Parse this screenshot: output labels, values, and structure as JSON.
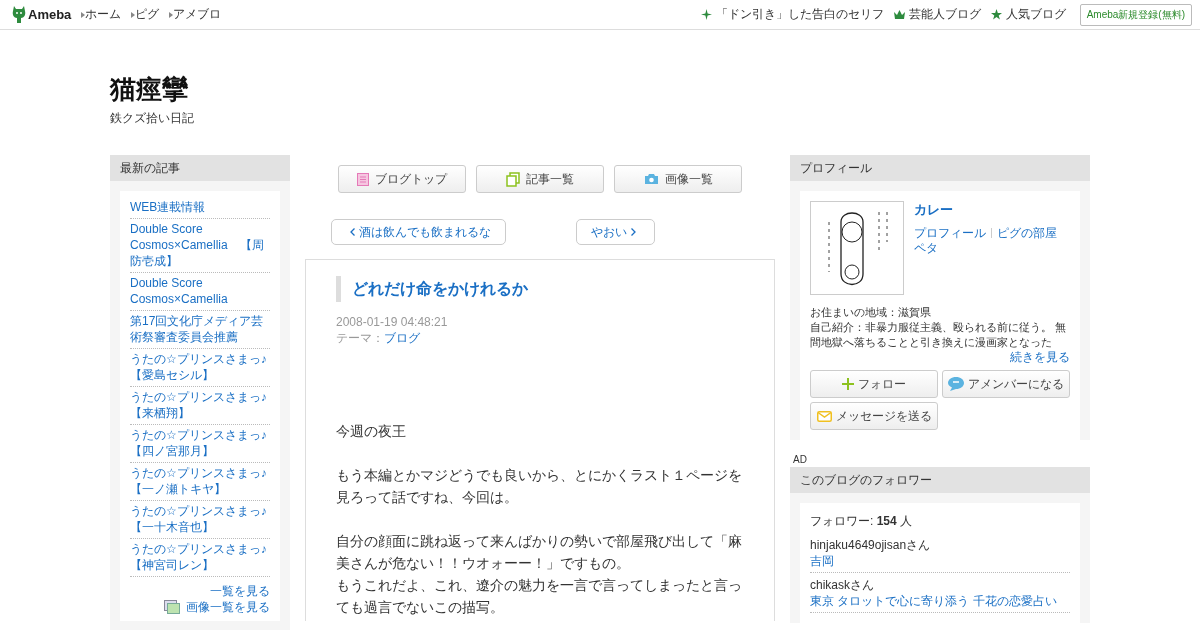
{
  "topbar": {
    "logo": "Ameba",
    "nav": [
      "ホーム",
      "ピグ",
      "アメブロ"
    ],
    "links": [
      {
        "kind": "sparkle",
        "label": "「ドン引き」した告白のセリフ"
      },
      {
        "kind": "crown",
        "label": "芸能人ブログ"
      },
      {
        "kind": "star",
        "label": "人気ブログ"
      }
    ],
    "register": "Ameba新規登録(無料)"
  },
  "blog": {
    "title": "猫痙攣",
    "subtitle": "鉄クズ拾い日記"
  },
  "recent": {
    "heading": "最新の記事",
    "items": [
      "WEB連載情報",
      "Double Score Cosmos×Camellia　【周防壱成】",
      "Double Score Cosmos×Camellia",
      "第17回文化庁メディア芸術祭審査委員会推薦",
      "うたの☆プリンスさまっ♪【愛島セシル】",
      "うたの☆プリンスさまっ♪【来栖翔】",
      "うたの☆プリンスさまっ♪【四ノ宮那月】",
      "うたの☆プリンスさまっ♪【一ノ瀬トキヤ】",
      "うたの☆プリンスさまっ♪【一十木音也】",
      "うたの☆プリンスさまっ♪【神宮司レン】"
    ],
    "more": "一覧を見る",
    "images_more": "画像一覧を見る"
  },
  "tabs": [
    {
      "kind": "page",
      "label": "ブログトップ"
    },
    {
      "kind": "docs",
      "label": "記事一覧"
    },
    {
      "kind": "camera",
      "label": "画像一覧"
    }
  ],
  "pager": {
    "prev": "酒は飲んでも飲まれるな",
    "next": "やおい"
  },
  "article": {
    "title": "どれだけ命をかけれるか",
    "date": "2008-01-19 04:48:21",
    "theme_label": "テーマ：",
    "theme": "ブログ",
    "paragraphs": [
      [
        "今週の夜王"
      ],
      [
        "もう本編とかマジどうでも良いから、とにかくラスト１ページを見ろって話ですね、今回は。"
      ],
      [
        "自分の顔面に跳ね返って来んばかりの勢いで部屋飛び出して「麻美さんが危ない！！ウオォーー！」ですもの。",
        "もうこれだよ、これ、遼介の魅力を一言で言ってしまったと言っても過言でないこの描写。"
      ]
    ]
  },
  "profile": {
    "heading": "プロフィール",
    "name": "カレー",
    "links": [
      "プロフィール",
      "ピグの部屋"
    ],
    "peta": "ペタ",
    "area": "お住まいの地域：滋賀県",
    "intro": "自己紹介：非暴力服従主義、殴られる前に従う。 無間地獄へ落ちることと引き換えに漫画家となった",
    "more": "続きを見る",
    "buttons": [
      {
        "kind": "follow",
        "label": "フォロー"
      },
      {
        "kind": "amember",
        "label": "アメンバーになる"
      },
      {
        "kind": "message",
        "label": "メッセージを送る"
      }
    ]
  },
  "ad": "AD",
  "followers": {
    "heading": "このブログのフォロワー",
    "count": "フォロワー: **154** 人",
    "items": [
      {
        "user": "hinjaku4649ojisanさん",
        "blog": "吉岡"
      },
      {
        "user": "chikaskさん",
        "blog": "東京 タロットで心に寄り添う 千花の恋愛占い"
      }
    ]
  }
}
